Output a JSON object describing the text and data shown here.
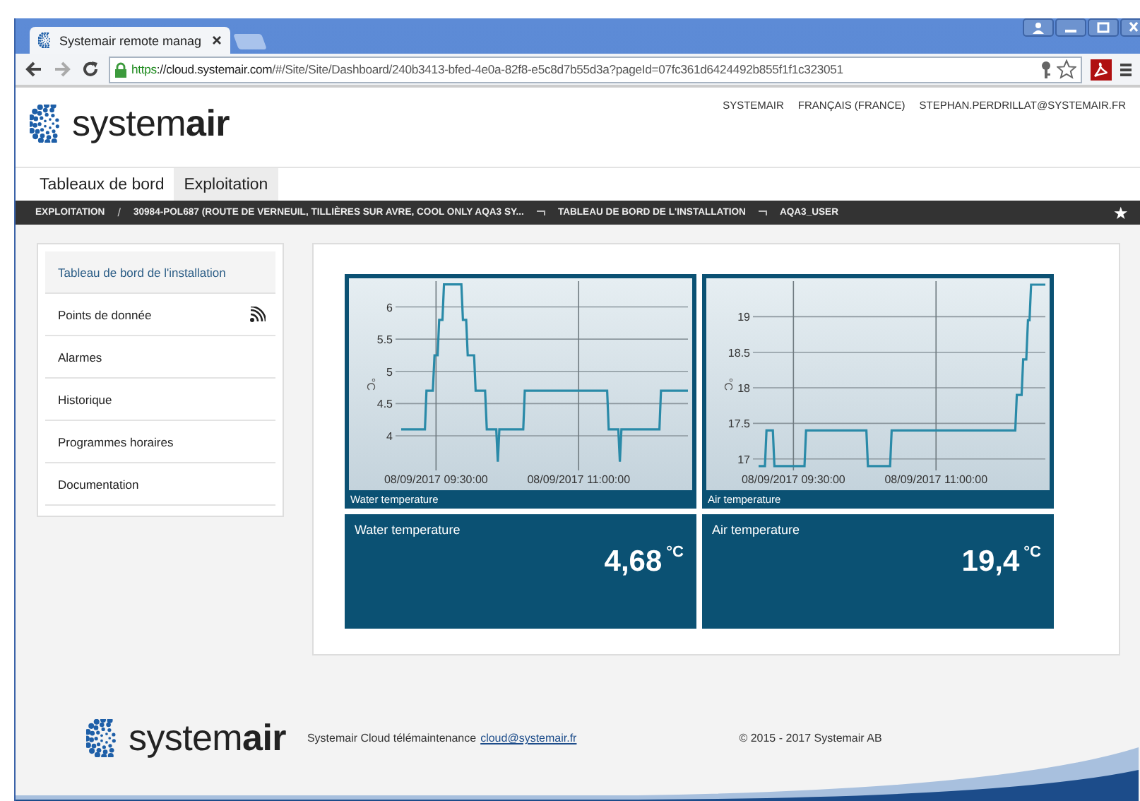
{
  "browser": {
    "tab_title": "Systemair remote manag",
    "url_scheme": "https",
    "url_host": "://cloud.systemair.com",
    "url_path": "/#/Site/Site/Dashboard/240b3413-bfed-4e0a-82f8-e5c8d7b55d3a?pageId=07fc361d6424492b855f1f1c323051"
  },
  "header": {
    "logo": "system**air**",
    "top_links": [
      "SYSTEMAIR",
      "FRANÇAIS (FRANCE)",
      "STEPHAN.PERDRILLAT@SYSTEMAIR.FR"
    ]
  },
  "nav_tabs": [
    {
      "label": "Tableaux de bord",
      "selected": false
    },
    {
      "label": "Exploitation",
      "selected": true
    }
  ],
  "breadcrumb": {
    "items": [
      {
        "label": "EXPLOITATION"
      },
      {
        "separator": "/",
        "label": "30984-POL687 (ROUTE DE VERNEUIL, TILLIÈRES SUR AVRE, COOL ONLY AQA3 SY..."
      },
      {
        "separator_icon": true,
        "label": "TABLEAU DE BORD DE L'INSTALLATION"
      },
      {
        "separator_icon": true,
        "label": "AQA3_USER"
      }
    ],
    "star": "★"
  },
  "sidebar": {
    "items": [
      {
        "label": "Tableau de bord de l'installation",
        "selected": true,
        "kind": "plain"
      },
      {
        "label": "Points de donnée",
        "selected": false,
        "kind": "feed"
      },
      {
        "label": "Alarmes",
        "selected": false,
        "kind": "plain"
      },
      {
        "label": "Historique",
        "selected": false,
        "kind": "plain"
      },
      {
        "label": "Programmes horaires",
        "selected": false,
        "kind": "plain"
      },
      {
        "label": "Documentation",
        "selected": false,
        "kind": "plain"
      }
    ]
  },
  "charts": [
    {
      "chart_data": {
        "type": "line",
        "title": "Water temperature",
        "grid": true,
        "ylabel": "°C",
        "ylim": [
          3.2,
          6.4
        ],
        "yticks": [
          4,
          4.5,
          5,
          5.5,
          6
        ],
        "categories": [
          null,
          null,
          null,
          null,
          null,
          null,
          null,
          null,
          null,
          null,
          null,
          null,
          null,
          null,
          null,
          null,
          null,
          null,
          null,
          null,
          null,
          null,
          "08/09/2017 09:30:00",
          null,
          null,
          null,
          null,
          null,
          null,
          null,
          null,
          null,
          null,
          null,
          null,
          null,
          null,
          null,
          null,
          null,
          null,
          null,
          null,
          null,
          null,
          null,
          null,
          null,
          null,
          null,
          null,
          null,
          null,
          null,
          null,
          null,
          null,
          null,
          null,
          null,
          null,
          null,
          null,
          null,
          null,
          null,
          null,
          null,
          null,
          null,
          null,
          null,
          null,
          null,
          null,
          null,
          null,
          null,
          null,
          null,
          null,
          null,
          null,
          null,
          null,
          null,
          null,
          null,
          null,
          null,
          null,
          null,
          null,
          null,
          null,
          null,
          null,
          null,
          null,
          null,
          null,
          null,
          null,
          null,
          null,
          null,
          null,
          null,
          null,
          null,
          null,
          null,
          "08/09/2017 11:00:00",
          null,
          null,
          null,
          null,
          null,
          null,
          null,
          null,
          null,
          null,
          null,
          null,
          null,
          null,
          null,
          null,
          null,
          null,
          null,
          null,
          null,
          null,
          null,
          null,
          null,
          null,
          null,
          null,
          null,
          null,
          null,
          null,
          null,
          null,
          null,
          null,
          null,
          null,
          null,
          null,
          null,
          null,
          null,
          null,
          null,
          null,
          null,
          null,
          null,
          null,
          null,
          null,
          null,
          null,
          null,
          null,
          null,
          null,
          null,
          null,
          null,
          null,
          null,
          null,
          null,
          null,
          null,
          null,
          null
        ],
        "values": [
          4.1,
          4.1,
          4.1,
          4.1,
          4.1,
          4.1,
          4.1,
          4.1,
          4.1,
          4.1,
          4.1,
          4.1,
          4.1,
          4.1,
          4.1,
          4.1,
          4.7,
          4.7,
          4.7,
          4.7,
          4.7,
          5.25,
          5.25,
          5.25,
          5.8,
          5.8,
          5.8,
          6.35,
          6.35,
          6.35,
          6.35,
          6.35,
          6.35,
          6.35,
          6.35,
          6.35,
          6.35,
          6.35,
          6.35,
          5.8,
          5.8,
          5.8,
          5.25,
          5.25,
          5.25,
          5.25,
          5.25,
          4.7,
          4.7,
          4.7,
          4.7,
          4.7,
          4.7,
          4.7,
          4.1,
          4.1,
          4.1,
          4.1,
          4.1,
          4.1,
          4.1,
          3.6,
          4.1,
          4.1,
          4.1,
          4.1,
          4.1,
          4.1,
          4.1,
          4.1,
          4.1,
          4.1,
          4.1,
          4.1,
          4.1,
          4.1,
          4.1,
          4.1,
          4.7,
          4.7,
          4.7,
          4.7,
          4.7,
          4.7,
          4.7,
          4.7,
          4.7,
          4.7,
          4.7,
          4.7,
          4.7,
          4.7,
          4.7,
          4.7,
          4.7,
          4.7,
          4.7,
          4.7,
          4.7,
          4.7,
          4.7,
          4.7,
          4.7,
          4.7,
          4.7,
          4.7,
          4.7,
          4.7,
          4.7,
          4.7,
          4.7,
          4.7,
          4.7,
          4.7,
          4.7,
          4.7,
          4.7,
          4.7,
          4.7,
          4.7,
          4.7,
          4.7,
          4.7,
          4.7,
          4.7,
          4.7,
          4.7,
          4.7,
          4.7,
          4.7,
          4.7,
          4.1,
          4.1,
          4.1,
          4.1,
          4.1,
          4.1,
          4.1,
          3.6,
          4.1,
          4.1,
          4.1,
          4.1,
          4.1,
          4.1,
          4.1,
          4.1,
          4.1,
          4.1,
          4.1,
          4.1,
          4.1,
          4.1,
          4.1,
          4.1,
          4.1,
          4.1,
          4.1,
          4.1,
          4.1,
          4.1,
          4.1,
          4.1,
          4.1,
          4.7,
          4.7,
          4.7,
          4.7,
          4.7,
          4.7,
          4.7,
          4.7,
          4.7,
          4.7,
          4.7,
          4.7,
          4.7,
          4.7,
          4.7,
          4.7,
          4.7,
          4.7
        ]
      }
    },
    {
      "chart_data": {
        "type": "line",
        "title": "Air temperature",
        "grid": true,
        "ylabel": "°C",
        "ylim": [
          16.6,
          19.5
        ],
        "yticks": [
          17,
          17.5,
          18,
          18.5,
          19
        ],
        "categories": [
          null,
          null,
          null,
          null,
          null,
          null,
          null,
          null,
          null,
          null,
          null,
          null,
          null,
          null,
          null,
          null,
          null,
          null,
          null,
          null,
          null,
          null,
          "08/09/2017 09:30:00",
          null,
          null,
          null,
          null,
          null,
          null,
          null,
          null,
          null,
          null,
          null,
          null,
          null,
          null,
          null,
          null,
          null,
          null,
          null,
          null,
          null,
          null,
          null,
          null,
          null,
          null,
          null,
          null,
          null,
          null,
          null,
          null,
          null,
          null,
          null,
          null,
          null,
          null,
          null,
          null,
          null,
          null,
          null,
          null,
          null,
          null,
          null,
          null,
          null,
          null,
          null,
          null,
          null,
          null,
          null,
          null,
          null,
          null,
          null,
          null,
          null,
          null,
          null,
          null,
          null,
          null,
          null,
          null,
          null,
          null,
          null,
          null,
          null,
          null,
          null,
          null,
          null,
          null,
          null,
          null,
          null,
          null,
          null,
          null,
          null,
          null,
          null,
          null,
          null,
          "08/09/2017 11:00:00",
          null,
          null,
          null,
          null,
          null,
          null,
          null,
          null,
          null,
          null,
          null,
          null,
          null,
          null,
          null,
          null,
          null,
          null,
          null,
          null,
          null,
          null,
          null,
          null,
          null,
          null,
          null,
          null,
          null,
          null,
          null,
          null,
          null,
          null,
          null,
          null,
          null,
          null,
          null,
          null,
          null,
          null,
          null,
          null,
          null,
          null,
          null,
          null,
          null,
          null,
          null,
          null,
          null,
          null,
          null,
          null,
          null,
          null,
          null,
          null,
          null,
          null,
          null,
          null,
          null,
          null,
          null,
          null,
          null
        ],
        "values": [
          16.9,
          16.9,
          16.9,
          16.9,
          16.9,
          17.4,
          17.4,
          17.4,
          17.4,
          17.4,
          16.9,
          16.9,
          16.9,
          16.9,
          16.9,
          16.9,
          16.9,
          16.9,
          16.9,
          16.9,
          16.9,
          16.9,
          16.9,
          16.9,
          16.9,
          16.9,
          16.9,
          16.9,
          16.9,
          16.9,
          17.4,
          17.4,
          17.4,
          17.4,
          17.4,
          17.4,
          17.4,
          17.4,
          17.4,
          17.4,
          17.4,
          17.4,
          17.4,
          17.4,
          17.4,
          17.4,
          17.4,
          17.4,
          17.4,
          17.4,
          17.4,
          17.4,
          17.4,
          17.4,
          17.4,
          17.4,
          17.4,
          17.4,
          17.4,
          17.4,
          17.4,
          17.4,
          17.4,
          17.4,
          17.4,
          17.4,
          17.4,
          17.4,
          17.4,
          16.9,
          16.9,
          16.9,
          16.9,
          16.9,
          16.9,
          16.9,
          16.9,
          16.9,
          16.9,
          16.9,
          16.9,
          16.9,
          16.9,
          16.9,
          17.4,
          17.4,
          17.4,
          17.4,
          17.4,
          17.4,
          17.4,
          17.4,
          17.4,
          17.4,
          17.4,
          17.4,
          17.4,
          17.4,
          17.4,
          17.4,
          17.4,
          17.4,
          17.4,
          17.4,
          17.4,
          17.4,
          17.4,
          17.4,
          17.4,
          17.4,
          17.4,
          17.4,
          17.4,
          17.4,
          17.4,
          17.4,
          17.4,
          17.4,
          17.4,
          17.4,
          17.4,
          17.4,
          17.4,
          17.4,
          17.4,
          17.4,
          17.4,
          17.4,
          17.4,
          17.4,
          17.4,
          17.4,
          17.4,
          17.4,
          17.4,
          17.4,
          17.4,
          17.4,
          17.4,
          17.4,
          17.4,
          17.4,
          17.4,
          17.4,
          17.4,
          17.4,
          17.4,
          17.4,
          17.4,
          17.4,
          17.4,
          17.4,
          17.4,
          17.4,
          17.4,
          17.4,
          17.4,
          17.4,
          17.4,
          17.4,
          17.4,
          17.4,
          17.4,
          17.9,
          17.9,
          17.9,
          17.9,
          18.4,
          18.4,
          18.4,
          18.95,
          18.95,
          19.45,
          19.45,
          19.45,
          19.45,
          19.45,
          19.45,
          19.45,
          19.45,
          19.45,
          19.45
        ]
      }
    }
  ],
  "values": [
    {
      "title": "Water temperature",
      "value": "4,68",
      "unit": "°C"
    },
    {
      "title": "Air temperature",
      "value": "19,4",
      "unit": "°C"
    }
  ],
  "footer": {
    "logo": "system**air**",
    "text": "Systemair Cloud télémaintenance",
    "link": "cloud@systemair.fr",
    "copyright": "© 2015 - 2017 Systemair AB"
  }
}
